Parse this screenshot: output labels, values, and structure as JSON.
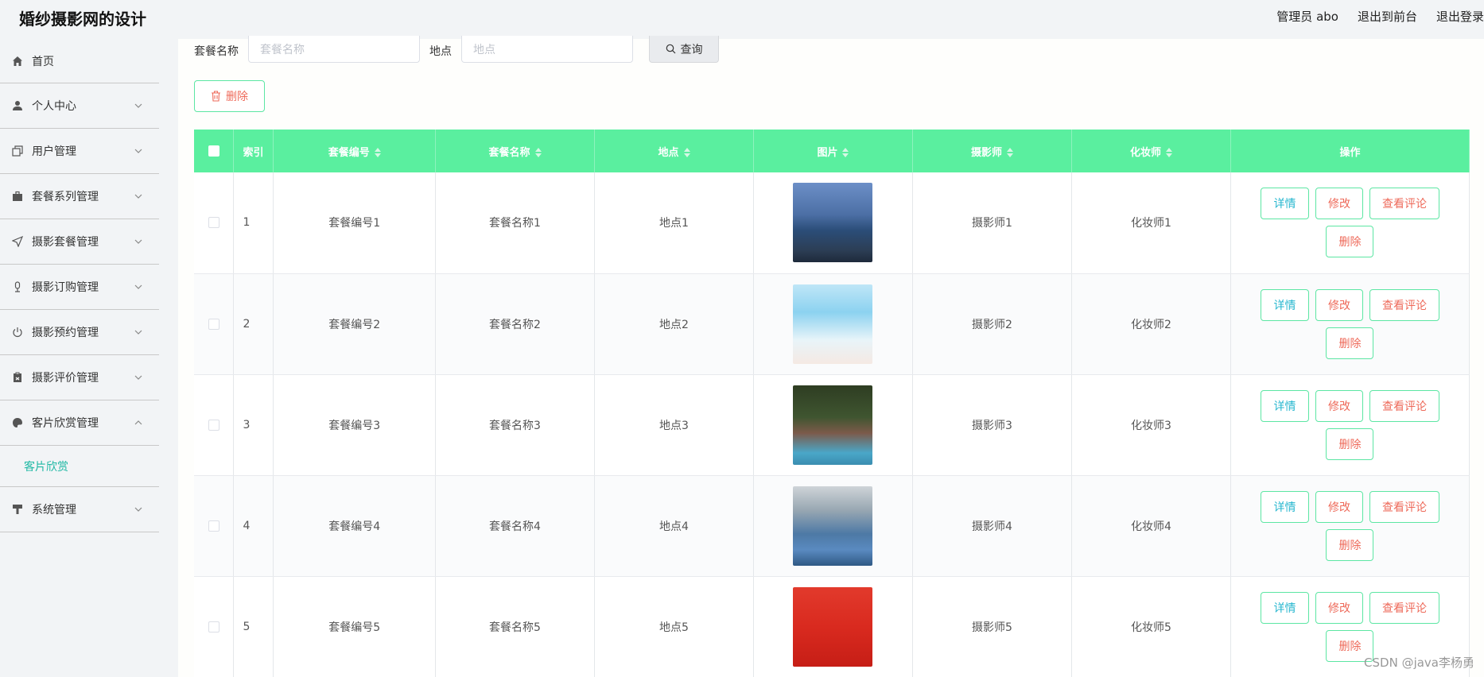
{
  "header": {
    "title": "婚纱摄影网的设计",
    "admin_label": "管理员 abo",
    "to_frontend": "退出到前台",
    "logout": "退出登录"
  },
  "sidebar": {
    "items": [
      {
        "label": "首页",
        "icon": "home-icon"
      },
      {
        "label": "个人中心",
        "icon": "user-icon"
      },
      {
        "label": "用户管理",
        "icon": "copy-icon"
      },
      {
        "label": "套餐系列管理",
        "icon": "briefcase-icon"
      },
      {
        "label": "摄影套餐管理",
        "icon": "send-icon"
      },
      {
        "label": "摄影订购管理",
        "icon": "microphone-icon"
      },
      {
        "label": "摄影预约管理",
        "icon": "power-icon"
      },
      {
        "label": "摄影评价管理",
        "icon": "clipboard-icon"
      },
      {
        "label": "客片欣赏管理",
        "icon": "palette-icon"
      },
      {
        "label": "系统管理",
        "icon": "paint-roller-icon"
      }
    ],
    "sub_item": "客片欣赏"
  },
  "search": {
    "name_label": "套餐名称",
    "name_placeholder": "套餐名称",
    "location_label": "地点",
    "location_placeholder": "地点",
    "button": "查询"
  },
  "batch_delete": "删除",
  "table": {
    "columns": [
      "索引",
      "套餐编号",
      "套餐名称",
      "地点",
      "图片",
      "摄影师",
      "化妆师",
      "操作"
    ],
    "rows": [
      {
        "index": "1",
        "code": "套餐编号1",
        "name": "套餐名称1",
        "location": "地点1",
        "photographer": "摄影师1",
        "makeup": "化妆师1"
      },
      {
        "index": "2",
        "code": "套餐编号2",
        "name": "套餐名称2",
        "location": "地点2",
        "photographer": "摄影师2",
        "makeup": "化妆师2"
      },
      {
        "index": "3",
        "code": "套餐编号3",
        "name": "套餐名称3",
        "location": "地点3",
        "photographer": "摄影师3",
        "makeup": "化妆师3"
      },
      {
        "index": "4",
        "code": "套餐编号4",
        "name": "套餐名称4",
        "location": "地点4",
        "photographer": "摄影师4",
        "makeup": "化妆师4"
      },
      {
        "index": "5",
        "code": "套餐编号5",
        "name": "套餐名称5",
        "location": "地点5",
        "photographer": "摄影师5",
        "makeup": "化妆师5"
      }
    ],
    "actions": {
      "detail": "详情",
      "edit": "修改",
      "comments": "查看评论",
      "delete": "删除"
    }
  },
  "watermark": "CSDN @java李杨勇",
  "colors": {
    "accent": "#5aef9f",
    "danger": "#ee6a5a",
    "info": "#27b7cf",
    "active_sub": "#1fb8a4"
  }
}
